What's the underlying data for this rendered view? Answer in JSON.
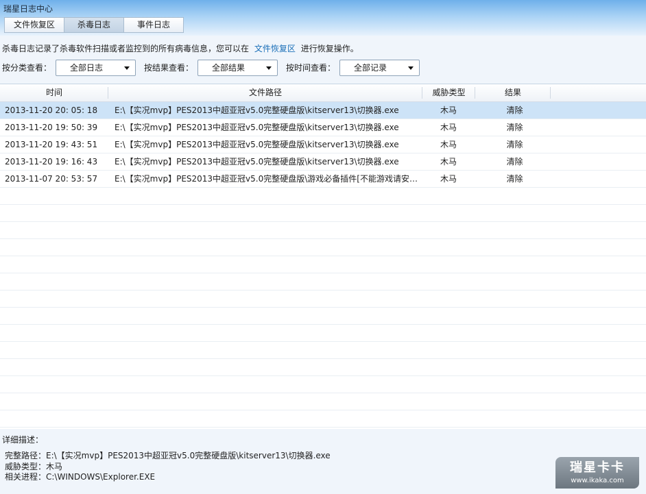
{
  "window": {
    "title": "瑞星日志中心"
  },
  "tabs": [
    {
      "label": "文件恢复区",
      "active": false
    },
    {
      "label": "杀毒日志",
      "active": true
    },
    {
      "label": "事件日志",
      "active": false
    }
  ],
  "info": {
    "before": "杀毒日志记录了杀毒软件扫描或者监控到的所有病毒信息，您可以在",
    "link": "文件恢复区",
    "after": "进行恢复操作。"
  },
  "filters": {
    "category": {
      "label": "按分类查看：",
      "value": "全部日志"
    },
    "result": {
      "label": "按结果查看：",
      "value": "全部结果"
    },
    "time": {
      "label": "按时间查看：",
      "value": "全部记录"
    }
  },
  "table": {
    "columns": [
      "时间",
      "文件路径",
      "威胁类型",
      "结果"
    ],
    "rows": [
      {
        "time": "2013-11-20 20: 05: 18",
        "path": "E:\\【实况mvp】PES2013中超亚冠v5.0完整硬盘版\\kitserver13\\切换器.exe",
        "type": "木马",
        "result": "清除",
        "selected": true
      },
      {
        "time": "2013-11-20 19: 50: 39",
        "path": "E:\\【实况mvp】PES2013中超亚冠v5.0完整硬盘版\\kitserver13\\切换器.exe",
        "type": "木马",
        "result": "清除",
        "selected": false
      },
      {
        "time": "2013-11-20 19: 43: 51",
        "path": "E:\\【实况mvp】PES2013中超亚冠v5.0完整硬盘版\\kitserver13\\切换器.exe",
        "type": "木马",
        "result": "清除",
        "selected": false
      },
      {
        "time": "2013-11-20 19: 16: 43",
        "path": "E:\\【实况mvp】PES2013中超亚冠v5.0完整硬盘版\\kitserver13\\切换器.exe",
        "type": "木马",
        "result": "清除",
        "selected": false
      },
      {
        "time": "2013-11-07 20: 53: 57",
        "path": "E:\\【实况mvp】PES2013中超亚冠v5.0完整硬盘版\\游戏必备插件[不能游戏请安…",
        "type": "木马",
        "result": "清除",
        "selected": false
      }
    ]
  },
  "detail": {
    "title": "详细描述：",
    "path": "完整路径：E:\\【实况mvp】PES2013中超亚冠v5.0完整硬盘版\\kitserver13\\切换器.exe",
    "threat": "威胁类型：木马",
    "process": "相关进程：C:\\WINDOWS\\Explorer.EXE"
  },
  "watermark": {
    "brand": "瑞星卡卡",
    "url": "www.ikaka.com"
  }
}
